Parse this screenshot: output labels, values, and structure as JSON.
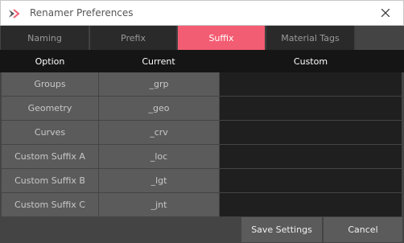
{
  "window": {
    "title": "Renamer Preferences",
    "app_icon": "app-logo-icon",
    "close_icon": "close-icon"
  },
  "tabs": [
    {
      "label": "Naming",
      "active": false
    },
    {
      "label": "Prefix",
      "active": false
    },
    {
      "label": "Suffix",
      "active": true
    },
    {
      "label": "Material Tags",
      "active": false
    }
  ],
  "table": {
    "headers": [
      "Option",
      "Current",
      "Custom"
    ],
    "rows": [
      {
        "option": "Groups",
        "current": "_grp",
        "custom": ""
      },
      {
        "option": "Geometry",
        "current": "_geo",
        "custom": ""
      },
      {
        "option": "Curves",
        "current": "_crv",
        "custom": ""
      },
      {
        "option": "Custom Suffix A",
        "current": "_loc",
        "custom": ""
      },
      {
        "option": "Custom Suffix B",
        "current": "_lgt",
        "custom": ""
      },
      {
        "option": "Custom Suffix C",
        "current": "_jnt",
        "custom": ""
      }
    ]
  },
  "footer": {
    "save_label": "Save Settings",
    "cancel_label": "Cancel"
  },
  "colors": {
    "accent": "#f35d73",
    "background": "#444444",
    "header": "#151515"
  }
}
